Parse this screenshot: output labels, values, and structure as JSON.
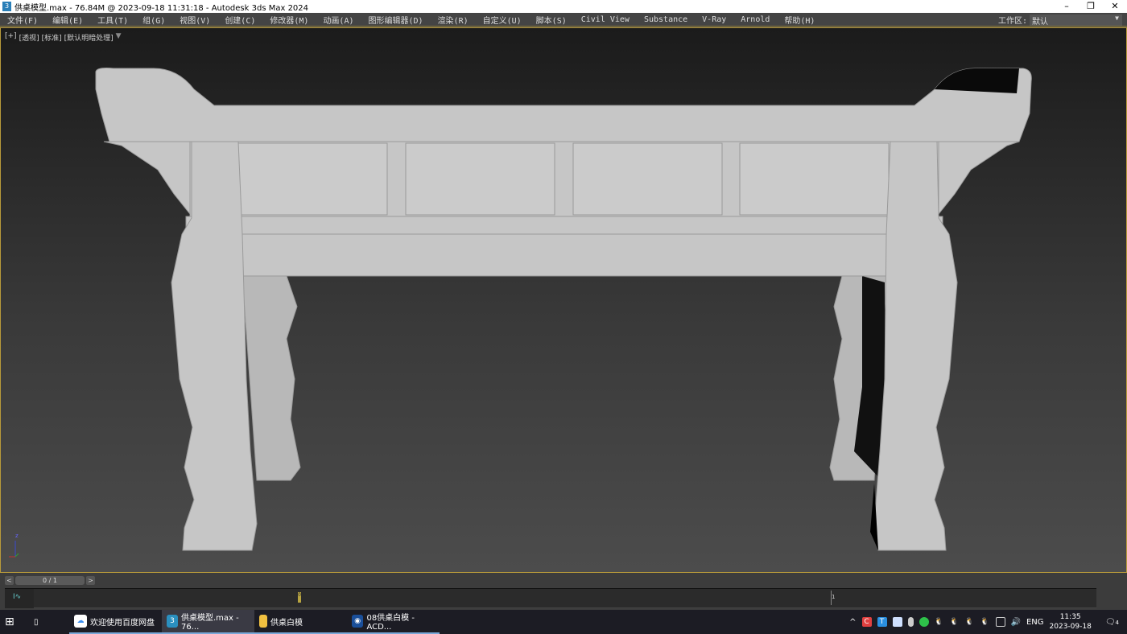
{
  "window": {
    "title": "供桌模型.max - 76.84M @ 2023-09-18 11:31:18 - Autodesk 3ds Max 2024",
    "app_icon": "3",
    "minimize": "–",
    "restore": "❐",
    "close": "✕"
  },
  "menu": [
    "文件(F)",
    "编辑(E)",
    "工具(T)",
    "组(G)",
    "视图(V)",
    "创建(C)",
    "修改器(M)",
    "动画(A)",
    "图形编辑器(D)",
    "渲染(R)",
    "自定义(U)",
    "脚本(S)",
    "Civil View",
    "Substance",
    "V-Ray",
    "Arnold",
    "帮助(H)"
  ],
  "workspace": {
    "label": "工作区:",
    "value": "默认"
  },
  "viewport": {
    "labels": [
      "[+]",
      "[透视]",
      "[标准]",
      "[默认明暗处理]"
    ],
    "filter_icon": "filter-icon",
    "axis": {
      "z": "z",
      "x": "x",
      "y": "y"
    }
  },
  "timeline": {
    "frame": "0 / 1",
    "prev": "<",
    "next": ">",
    "key_label": "0",
    "end_label": "1",
    "curve_icon": "I∿"
  },
  "taskbar": {
    "apps": [
      {
        "label": "欢迎使用百度网盘",
        "icon": "baidu-icon"
      },
      {
        "label": "供桌模型.max - 76...",
        "icon": "3dsmax-icon",
        "active": true
      },
      {
        "label": "供桌白模",
        "icon": "folder-icon"
      },
      {
        "label": "08供桌白模 - ACD...",
        "icon": "acdsee-icon"
      }
    ],
    "tray": {
      "lang": "ENG",
      "time": "11:35",
      "date": "2023-09-18",
      "notifications": "4"
    }
  },
  "colors": {
    "viewport_border": "#b89a3a",
    "model": "#c8c8c8"
  }
}
